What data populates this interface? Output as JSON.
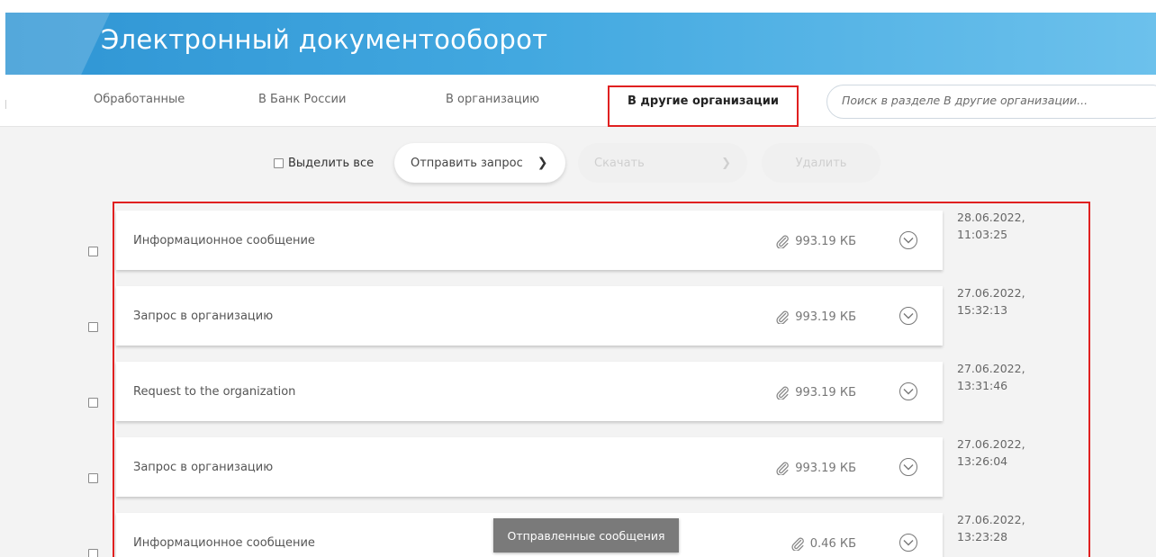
{
  "header": {
    "title": "Электронный документооборот"
  },
  "tabs": [
    {
      "label": "Обработанные"
    },
    {
      "label": "В Банк России"
    },
    {
      "label": "В организацию"
    },
    {
      "label": "В другие организации"
    }
  ],
  "search": {
    "placeholder": "Поиск в разделе В другие организации..."
  },
  "toolbar": {
    "select_all_label": "Выделить все",
    "send_request_label": "Отправить запрос",
    "download_label": "Скачать",
    "delete_label": "Удалить"
  },
  "messages": [
    {
      "title": "Информационное сообщение",
      "size": "993.19 КБ",
      "date": "28.06.2022,",
      "time": "11:03:25"
    },
    {
      "title": "Запрос в организацию",
      "size": "993.19 КБ",
      "date": "27.06.2022,",
      "time": "15:32:13"
    },
    {
      "title": "Request to the organization",
      "size": "993.19 КБ",
      "date": "27.06.2022,",
      "time": "13:31:46"
    },
    {
      "title": "Запрос в организацию",
      "size": "993.19 КБ",
      "date": "27.06.2022,",
      "time": "13:26:04"
    },
    {
      "title": "Информационное сообщение",
      "size": "0.46 КБ",
      "date": "27.06.2022,",
      "time": "13:23:28"
    }
  ],
  "toast": {
    "text": "Отправленные сообщения"
  },
  "colors": {
    "banner": "#42a8e0",
    "highlight": "#e02020"
  }
}
